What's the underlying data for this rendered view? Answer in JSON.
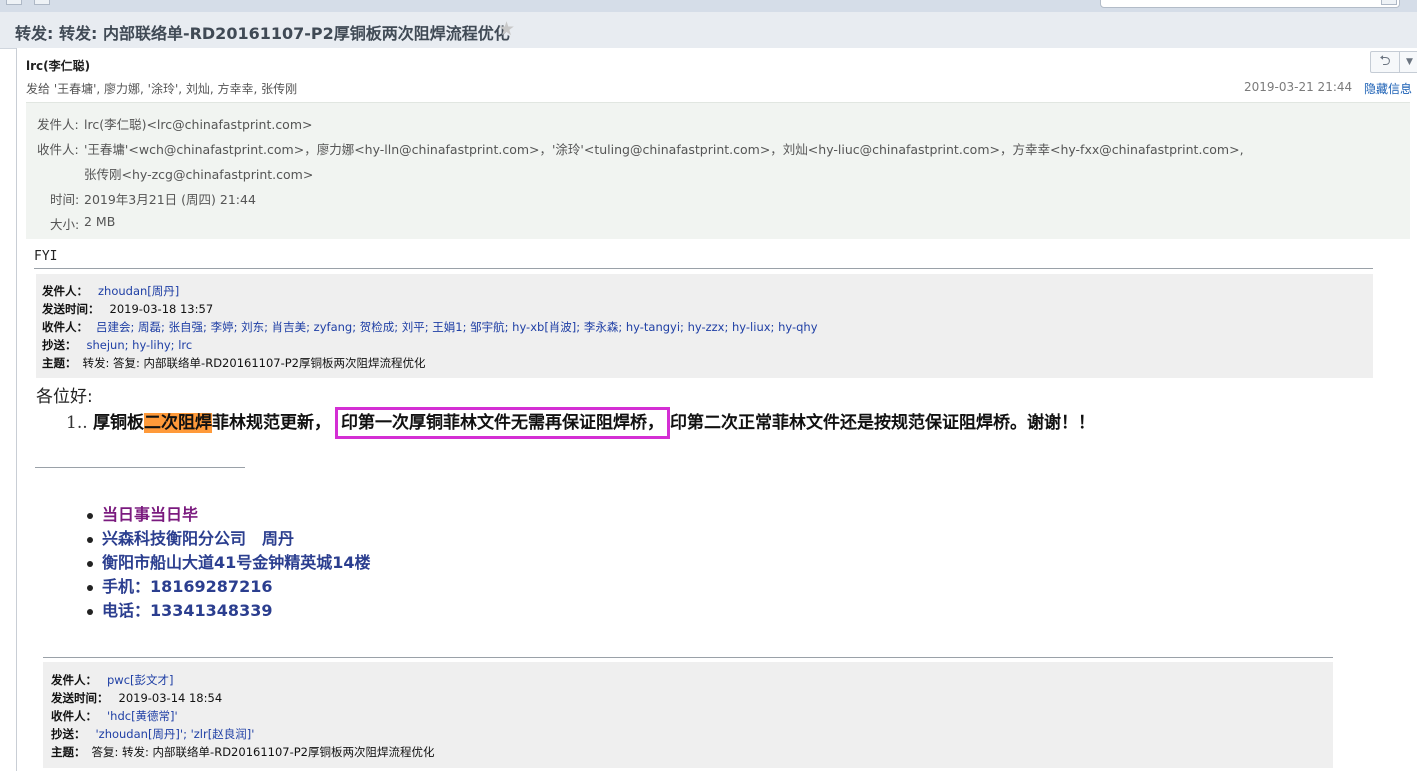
{
  "subject": "转发: 转发: 内部联络单-RD20161107-P2厚铜板两次阻焊流程优化",
  "header": {
    "sender_name": "lrc(李仁聪)",
    "sent_to": "发给 '王春墉', 廖力娜, '涂玲', 刘灿, 方幸幸, 张传刚",
    "date": "2019-03-21 21:44",
    "hide_info": "隐藏信息"
  },
  "details": {
    "from_label": "发件人:",
    "from_value": "lrc(李仁聪)<lrc@chinafastprint.com>",
    "to_label": "收件人:",
    "to_line1": "'王春墉'<wch@chinafastprint.com>，廖力娜<hy-lln@chinafastprint.com>，'涂玲'<tuling@chinafastprint.com>，刘灿<hy-liuc@chinafastprint.com>，方幸幸<hy-fxx@chinafastprint.com>,",
    "to_line2": "张传刚<hy-zcg@chinafastprint.com>",
    "time_label": "时间:",
    "time_value": "2019年3月21日 (周四) 21:44",
    "size_label": "大小:",
    "size_value": "2 MB"
  },
  "body": {
    "fyi": "FYI",
    "quote1": {
      "from_label": "发件人：",
      "from_value": "zhoudan[周丹]",
      "sent_label": "发送时间：",
      "sent_value": "2019-03-18 13:57",
      "to_label": "收件人：",
      "to_value": "吕建会; 周磊; 张自强; 李婷; 刘东; 肖吉美; zyfang; 贺检成; 刘平; 王娟1; 邹宇航; hy-xb[肖波]; 李永森; hy-tangyi; hy-zzx; hy-liux; hy-qhy",
      "cc_label": "抄送：",
      "cc_value": "shejun; hy-lihy; lrc",
      "subject_label": "主题：",
      "subject_value": "转发: 答复: 内部联络单-RD20161107-P2厚铜板两次阻焊流程优化"
    },
    "greeting": "各位好:",
    "item1": {
      "number": "1..",
      "part1": "厚铜板",
      "highlight": "二次阻焊",
      "part2": "菲林规范更新，",
      "boxed": "印第一次厚铜菲林文件无需再保证阻焊桥，",
      "part3": "印第二次正常菲林文件还是按规范保证阻焊桥。谢谢！！"
    },
    "signature": [
      {
        "text": "当日事当日毕",
        "color": "#7a1a7e"
      },
      {
        "text": "兴森科技衡阳分公司　周丹",
        "color": "#2b3e8f"
      },
      {
        "text": "衡阳市船山大道41号金钟精英城14楼",
        "color": "#2b3e8f"
      },
      {
        "text": "手机：18169287216",
        "color": "#2b3e8f"
      },
      {
        "text": "电话：13341348339",
        "color": "#2b3e8f"
      }
    ],
    "quote2": {
      "from_label": "发件人：",
      "from_value": "pwc[彭文才]",
      "sent_label": "发送时间：",
      "sent_value": "2019-03-14 18:54",
      "to_label": "收件人：",
      "to_value": "'hdc[黄德常]'",
      "cc_label": "抄送：",
      "cc_value": "'zhoudan[周丹]'; 'zlr[赵良润]'",
      "subject_label": "主题：",
      "subject_value": "答复: 转发: 内部联络单-RD20161107-P2厚铜板两次阻焊流程优化"
    }
  }
}
